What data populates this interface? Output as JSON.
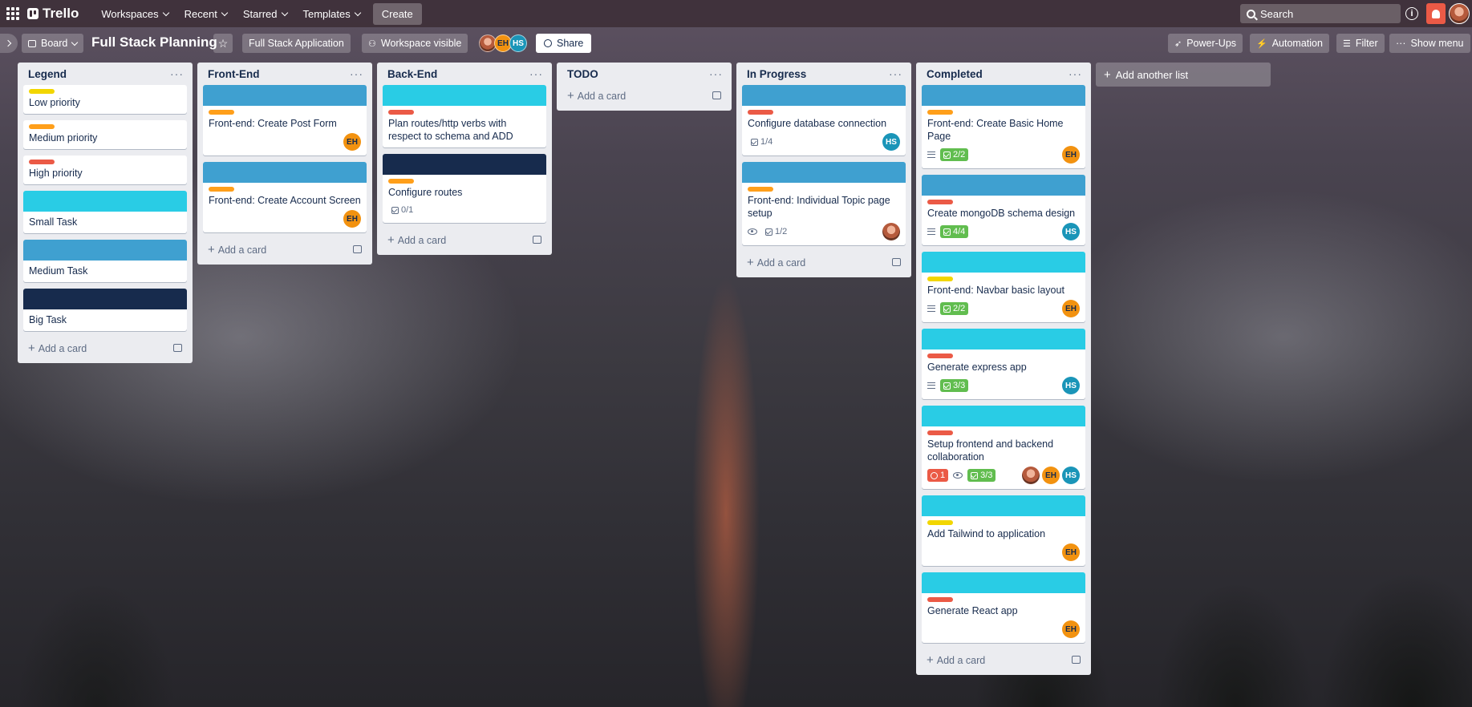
{
  "nav": {
    "logo": "Trello",
    "workspaces": "Workspaces",
    "recent": "Recent",
    "starred": "Starred",
    "templates": "Templates",
    "create": "Create",
    "search_placeholder": "Search",
    "info": "i"
  },
  "board": {
    "view": "Board",
    "title": "Full Stack Planning",
    "workspace_name": "Full Stack Application",
    "visibility": "Workspace visible",
    "share": "Share",
    "power_ups": "Power-Ups",
    "automation": "Automation",
    "filter": "Filter",
    "show_menu": "Show menu",
    "members": [
      "EH",
      "HS"
    ]
  },
  "colors": {
    "yellow": "#f2d600",
    "orange": "#ff9f1a",
    "red": "#eb5a46",
    "cyan": "#29cce5",
    "blue": "#3fa0d0",
    "navy": "#172b4d"
  },
  "lists": {
    "legend": {
      "title": "Legend",
      "cards": [
        "Low priority",
        "Medium priority",
        "High priority",
        "Small Task",
        "Medium Task",
        "Big Task"
      ],
      "add": "Add a card"
    },
    "frontend": {
      "title": "Front-End",
      "cards": [
        {
          "title": "Front-end: Create Post Form",
          "member": "EH"
        },
        {
          "title": "Front-end: Create Account Screen",
          "member": "EH"
        }
      ],
      "add": "Add a card"
    },
    "backend": {
      "title": "Back-End",
      "cards": [
        {
          "title": "Plan routes/http verbs with respect to schema and ADD"
        },
        {
          "title": "Configure routes",
          "checklist": "0/1"
        }
      ],
      "add": "Add a card"
    },
    "todo": {
      "title": "TODO",
      "add": "Add a card"
    },
    "inprogress": {
      "title": "In Progress",
      "cards": [
        {
          "title": "Configure database connection",
          "checklist": "1/4",
          "member": "HS"
        },
        {
          "title": "Front-end: Individual Topic page setup",
          "checklist": "1/2"
        }
      ],
      "add": "Add a card"
    },
    "completed": {
      "title": "Completed",
      "cards": [
        {
          "title": "Front-end: Create Basic Home Page",
          "checklist": "2/2",
          "member": "EH"
        },
        {
          "title": "Create mongoDB schema design",
          "checklist": "4/4",
          "member": "HS"
        },
        {
          "title": "Front-end: Navbar basic layout",
          "checklist": "2/2",
          "member": "EH"
        },
        {
          "title": "Generate express app",
          "checklist": "3/3",
          "member": "HS"
        },
        {
          "title": "Setup frontend and backend collaboration",
          "due": "1",
          "checklist": "3/3",
          "members": [
            "EH",
            "HS"
          ]
        },
        {
          "title": "Add Tailwind to application",
          "member": "EH"
        },
        {
          "title": "Generate React app",
          "member": "EH"
        }
      ],
      "add": "Add a card"
    }
  },
  "add_list": "Add another list"
}
